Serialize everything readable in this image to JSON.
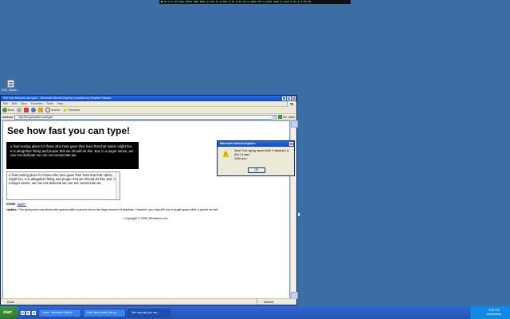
{
  "topbar": {
    "text": "■ 10.0.0.102  ▪▪▪  RTR51 NN6 RRS3  ▪ CPU 6%  ▪ NET 0.2k  ▪ IO 40  ▪ SWAP OFF  ▪ DISK 32GB  ▪ LOAD 0.00  ▪ 5:59 PM"
  },
  "desktop_icon": {
    "label": "DSK_Studio..."
  },
  "window": {
    "title": "See how fast you can type! - Microsoft Internet Explorer provided by Hewlett-Packard",
    "menu": [
      "File",
      "Edit",
      "View",
      "Favorites",
      "Tools",
      "Help"
    ],
    "toolbar": {
      "back": "Back",
      "search": "Search",
      "favorites": "Favorites"
    },
    "address": {
      "label": "Address",
      "url": "http://doc.jphantom.com/type/",
      "go": "Go",
      "links": "Links"
    },
    "status": {
      "text": "Done",
      "zone": "Internet"
    }
  },
  "page": {
    "heading": "See how fast you can type!",
    "passage": "a final resting place for those who here gave their lives that that nation might live. It is altogether fitting and proper that we should do this. But, in a larger sense, we can not dedicate we can not consecrate we",
    "typed": "a final resting place for those who here gave their lives that that nation might live. It is altogether fitting and proper that we should do this. But, in a larger sense, we can not dedicate we can not consecrate we",
    "done_label": "DONE!",
    "again_link": "Again?",
    "update_label": "Update:",
    "update_text": "This typing test now allows two spaces after a period due to the large amount of requests. However, you may still use a single space after a period as well.",
    "copyright": "Copyright © 2006 JPhantom.com"
  },
  "dialog": {
    "title": "Microsoft Internet Explorer",
    "message_line1": "Wow! Your typing speed (with 0 mistakes) is:",
    "message_line2": "(81) 14 wpm",
    "message_line3": "4490 cpm",
    "ok": "OK",
    "close": "×"
  },
  "taskbar": {
    "start": "start",
    "tasks": [
      {
        "label": "Inbox - Microsoft Outlook"
      },
      {
        "label": "How many words can yo..."
      },
      {
        "label": "See how fast you can ..."
      }
    ],
    "time": "5:59 PM",
    "day": "Wednesday"
  }
}
